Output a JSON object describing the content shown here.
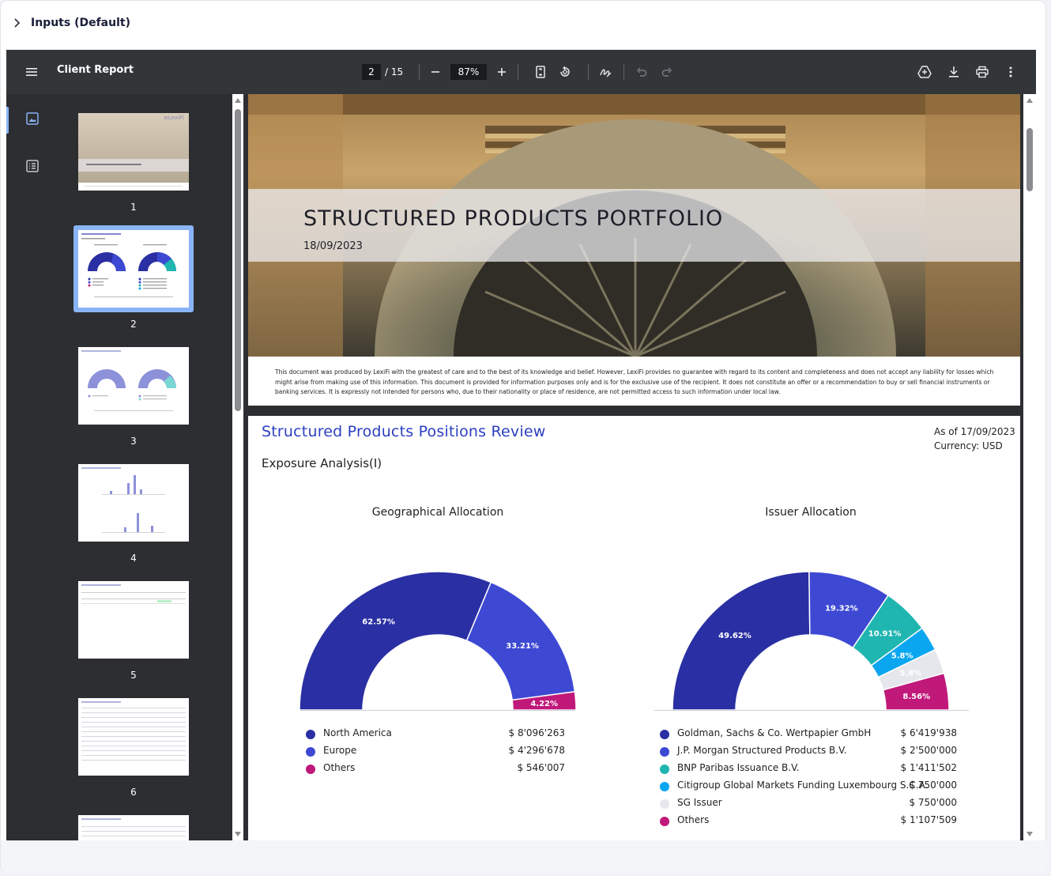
{
  "inputs_header": {
    "title": "Inputs (Default)"
  },
  "viewer": {
    "toolbar": {
      "doc_title": "Client Report",
      "current_page": "2",
      "total_pages": "/ 15",
      "zoom": "87%"
    },
    "thumbnails": [
      {
        "num": "1"
      },
      {
        "num": "2"
      },
      {
        "num": "3"
      },
      {
        "num": "4"
      },
      {
        "num": "5"
      },
      {
        "num": "6"
      }
    ],
    "selected_page": 2
  },
  "page1": {
    "title": "STRUCTURED PRODUCTS PORTFOLIO",
    "date": "18/09/2023",
    "disclaimer": "This document was produced by LexiFi with the greatest of care and to the best of its knowledge and belief. However, LexiFi provides no guarantee with regard to its content and completeness and does not accept any liability for losses which might arise from making use of this information. This document is provided for information purposes only and is for the exclusive use of the recipient. It does not constitute an offer or a recommendation to buy or sell financial instruments or banking services. It is expressly not intended for persons who, due to their nationality or place of residence, are not permitted access to such information under local law."
  },
  "page2": {
    "title": "Structured Products Positions Review",
    "as_of": "As of 17/09/2023",
    "currency": "Currency: USD",
    "subtitle": "Exposure Analysis(I)"
  },
  "chart_data": [
    {
      "type": "pie",
      "title": "Geographical Allocation",
      "categories": [
        "North America",
        "Europe",
        "Others"
      ],
      "values": [
        62.57,
        33.21,
        4.22
      ],
      "labels": [
        "62.57%",
        "33.21%",
        "4.22%"
      ],
      "amounts": [
        "$ 8'096'263",
        "$ 4'296'678",
        "$ 546'007"
      ],
      "colors": [
        "#2a2fa3",
        "#3d49d3",
        "#c0197a"
      ]
    },
    {
      "type": "pie",
      "title": "Issuer Allocation",
      "categories": [
        "Goldman, Sachs & Co. Wertpapier GmbH",
        "J.P. Morgan Structured Products B.V.",
        "BNP Paribas Issuance B.V.",
        "Citigroup Global Markets Funding Luxembourg S.C.A.",
        "SG Issuer",
        "Others"
      ],
      "values": [
        49.62,
        19.32,
        10.91,
        5.8,
        5.8,
        8.56
      ],
      "labels": [
        "49.62%",
        "19.32%",
        "10.91%",
        "5.8%",
        "5.8%",
        "8.56%"
      ],
      "amounts": [
        "$ 6'419'938",
        "$ 2'500'000",
        "$ 1'411'502",
        "$ 750'000",
        "$ 750'000",
        "$ 1'107'509"
      ],
      "colors": [
        "#2a2fa3",
        "#3d49d3",
        "#1fb5b0",
        "#0aa6f0",
        "#e6e7ec",
        "#c0197a"
      ]
    }
  ]
}
